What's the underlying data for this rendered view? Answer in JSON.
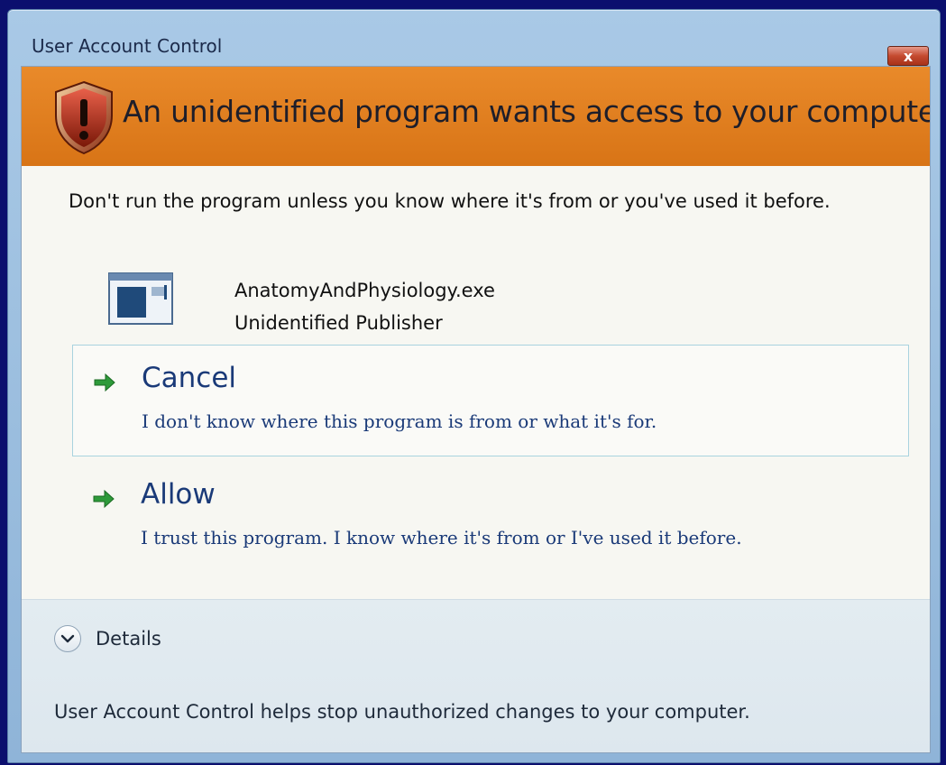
{
  "window": {
    "title": "User Account Control",
    "close_label": "x"
  },
  "banner": {
    "heading": "An unidentified program wants access to your computer",
    "icon": "shield-warning-icon",
    "color": "#e08020"
  },
  "warning_text": "Don't run the program unless you know where it's from or you've used it before.",
  "program": {
    "icon": "program-window-icon",
    "name": "AnatomyAndPhysiology.exe",
    "publisher": "Unidentified Publisher"
  },
  "options": {
    "cancel": {
      "title": "Cancel",
      "description": "I don't know where this program is from or what it's for.",
      "icon": "green-arrow-icon"
    },
    "allow": {
      "title": "Allow",
      "description": "I trust this program. I know where it's from or I've used it before.",
      "icon": "green-arrow-icon"
    }
  },
  "details": {
    "label": "Details",
    "icon": "chevron-down-icon"
  },
  "footer": {
    "text": "User Account Control helps stop unauthorized changes to your computer."
  }
}
